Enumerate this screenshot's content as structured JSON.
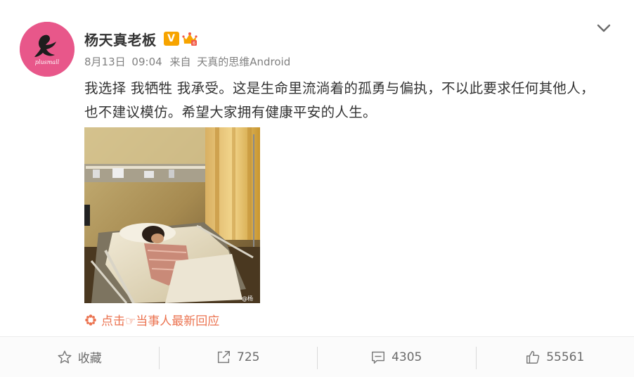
{
  "post": {
    "author": "杨天真老板",
    "vip_badge": "V",
    "date": "8月13日",
    "time": "09:04",
    "from_label": "来自",
    "source": "天真的思维Android",
    "text": "我选择 我牺牲 我承受。这是生命里流淌着的孤勇与偏执，不以此要求任何其他人，也不建议模仿。希望大家拥有健康平安的人生。",
    "image_watermark": "@杨",
    "reply_link": "点击☞当事人最新回应"
  },
  "avatar": {
    "brand_text": "plusmall",
    "background": "#e8578a"
  },
  "actions": [
    {
      "label": "收藏",
      "icon": "star-icon"
    },
    {
      "label": "725",
      "icon": "share-icon"
    },
    {
      "label": "4305",
      "icon": "comment-icon"
    },
    {
      "label": "55561",
      "icon": "thumbs-up-icon"
    }
  ],
  "colors": {
    "link": "#eb7350",
    "vip_badge": "#f7a400",
    "text": "#333333",
    "meta": "#808080"
  }
}
